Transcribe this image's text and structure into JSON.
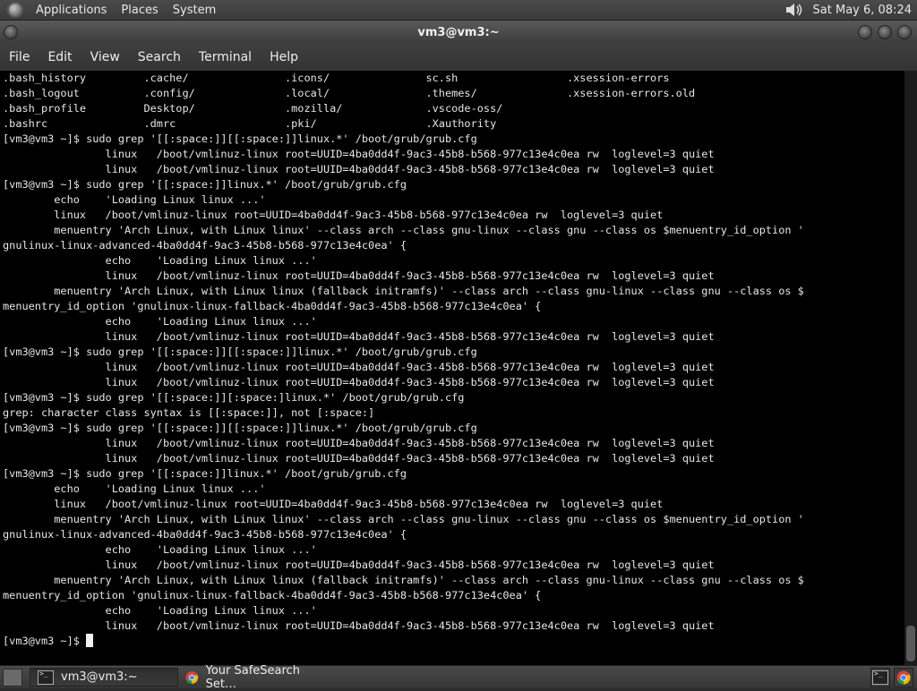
{
  "panel": {
    "menus": [
      "Applications",
      "Places",
      "System"
    ],
    "clock": "Sat May  6, 08:24"
  },
  "window": {
    "title": "vm3@vm3:~",
    "menu": [
      "File",
      "Edit",
      "View",
      "Search",
      "Terminal",
      "Help"
    ]
  },
  "terminal": {
    "lines": [
      ".bash_history         .cache/               .icons/               sc.sh                 .xsession-errors",
      ".bash_logout          .config/              .local/               .themes/              .xsession-errors.old",
      ".bash_profile         Desktop/              .mozilla/             .vscode-oss/",
      ".bashrc               .dmrc                 .pki/                 .Xauthority",
      "[vm3@vm3 ~]$ sudo grep '[[:space:]][[:space:]]linux.*' /boot/grub/grub.cfg",
      "                linux   /boot/vmlinuz-linux root=UUID=4ba0dd4f-9ac3-45b8-b568-977c13e4c0ea rw  loglevel=3 quiet",
      "                linux   /boot/vmlinuz-linux root=UUID=4ba0dd4f-9ac3-45b8-b568-977c13e4c0ea rw  loglevel=3 quiet",
      "[vm3@vm3 ~]$ sudo grep '[[:space:]]linux.*' /boot/grub/grub.cfg",
      "        echo    'Loading Linux linux ...'",
      "        linux   /boot/vmlinuz-linux root=UUID=4ba0dd4f-9ac3-45b8-b568-977c13e4c0ea rw  loglevel=3 quiet",
      "        menuentry 'Arch Linux, with Linux linux' --class arch --class gnu-linux --class gnu --class os $menuentry_id_option '",
      "gnulinux-linux-advanced-4ba0dd4f-9ac3-45b8-b568-977c13e4c0ea' {",
      "                echo    'Loading Linux linux ...'",
      "                linux   /boot/vmlinuz-linux root=UUID=4ba0dd4f-9ac3-45b8-b568-977c13e4c0ea rw  loglevel=3 quiet",
      "        menuentry 'Arch Linux, with Linux linux (fallback initramfs)' --class arch --class gnu-linux --class gnu --class os $",
      "menuentry_id_option 'gnulinux-linux-fallback-4ba0dd4f-9ac3-45b8-b568-977c13e4c0ea' {",
      "                echo    'Loading Linux linux ...'",
      "                linux   /boot/vmlinuz-linux root=UUID=4ba0dd4f-9ac3-45b8-b568-977c13e4c0ea rw  loglevel=3 quiet",
      "[vm3@vm3 ~]$ sudo grep '[[:space:]][[:space:]]linux.*' /boot/grub/grub.cfg",
      "                linux   /boot/vmlinuz-linux root=UUID=4ba0dd4f-9ac3-45b8-b568-977c13e4c0ea rw  loglevel=3 quiet",
      "                linux   /boot/vmlinuz-linux root=UUID=4ba0dd4f-9ac3-45b8-b568-977c13e4c0ea rw  loglevel=3 quiet",
      "[vm3@vm3 ~]$ sudo grep '[[:space:]][:space:]linux.*' /boot/grub/grub.cfg",
      "grep: character class syntax is [[:space:]], not [:space:]",
      "[vm3@vm3 ~]$ sudo grep '[[:space:]][[:space:]]linux.*' /boot/grub/grub.cfg",
      "                linux   /boot/vmlinuz-linux root=UUID=4ba0dd4f-9ac3-45b8-b568-977c13e4c0ea rw  loglevel=3 quiet",
      "                linux   /boot/vmlinuz-linux root=UUID=4ba0dd4f-9ac3-45b8-b568-977c13e4c0ea rw  loglevel=3 quiet",
      "[vm3@vm3 ~]$ sudo grep '[[:space:]]linux.*' /boot/grub/grub.cfg",
      "        echo    'Loading Linux linux ...'",
      "        linux   /boot/vmlinuz-linux root=UUID=4ba0dd4f-9ac3-45b8-b568-977c13e4c0ea rw  loglevel=3 quiet",
      "        menuentry 'Arch Linux, with Linux linux' --class arch --class gnu-linux --class gnu --class os $menuentry_id_option '",
      "gnulinux-linux-advanced-4ba0dd4f-9ac3-45b8-b568-977c13e4c0ea' {",
      "                echo    'Loading Linux linux ...'",
      "                linux   /boot/vmlinuz-linux root=UUID=4ba0dd4f-9ac3-45b8-b568-977c13e4c0ea rw  loglevel=3 quiet",
      "        menuentry 'Arch Linux, with Linux linux (fallback initramfs)' --class arch --class gnu-linux --class gnu --class os $",
      "menuentry_id_option 'gnulinux-linux-fallback-4ba0dd4f-9ac3-45b8-b568-977c13e4c0ea' {",
      "                echo    'Loading Linux linux ...'",
      "                linux   /boot/vmlinuz-linux root=UUID=4ba0dd4f-9ac3-45b8-b568-977c13e4c0ea rw  loglevel=3 quiet"
    ],
    "prompt": "[vm3@vm3 ~]$ "
  },
  "taskbar": {
    "tasks": [
      {
        "label": "vm3@vm3:~",
        "icon": "terminal-icon"
      },
      {
        "label": "Your SafeSearch Set…",
        "icon": "chrome-icon"
      }
    ]
  },
  "colors": {
    "terminal_bg": "#000000",
    "terminal_fg": "#e6e6e6",
    "panel_bg": "#3f3f3f"
  }
}
